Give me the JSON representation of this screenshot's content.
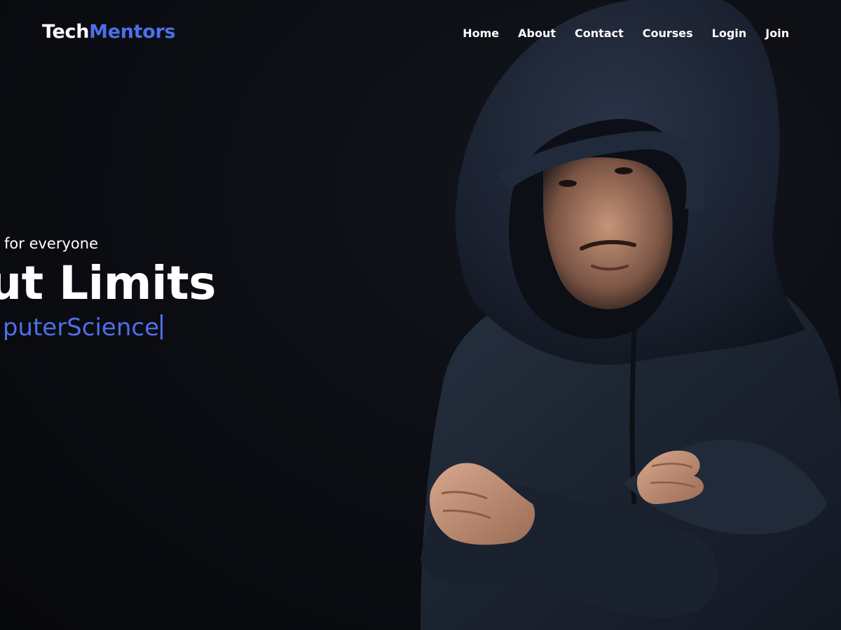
{
  "brand": {
    "part1": "Tech",
    "part2": "Mentors"
  },
  "nav": {
    "items": [
      {
        "label": "Home"
      },
      {
        "label": "About"
      },
      {
        "label": "Contact"
      },
      {
        "label": "Courses"
      },
      {
        "label": "Login"
      },
      {
        "label": "Join"
      }
    ]
  },
  "hero": {
    "subtitle": "for everyone",
    "title": "out Limits",
    "typed_text": "puterScience"
  },
  "colors": {
    "background": "#0b0d12",
    "accent": "#4d6fe6",
    "text": "#ffffff",
    "hoodie": "#1c2433"
  }
}
